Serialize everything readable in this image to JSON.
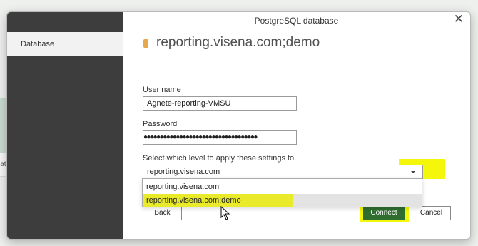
{
  "background": {
    "partial_label": "lat"
  },
  "dialog": {
    "title": "PostgreSQL database",
    "close_glyph": "✕",
    "sidebar": {
      "items": [
        {
          "label": "Database"
        }
      ]
    },
    "heading": "reporting.visena.com;demo",
    "username": {
      "label": "User name",
      "value": "Agnete-reporting-VMSU"
    },
    "password": {
      "label": "Password",
      "value": "●●●●●●●●●●●●●●●●●●●●●●●●●●●●●●●●●●●"
    },
    "level": {
      "label": "Select which level to apply these settings to",
      "selected": "reporting.visena.com",
      "options": [
        "reporting.visena.com",
        "reporting.visena.com;demo"
      ]
    },
    "buttons": {
      "back": "Back",
      "connect": "Connect",
      "cancel": "Cancel"
    },
    "colors": {
      "highlight": "#f5f70a",
      "connect": "#2f6e2f",
      "sidebar": "#3d3d3d",
      "db_icon": "#e5a84a"
    }
  }
}
